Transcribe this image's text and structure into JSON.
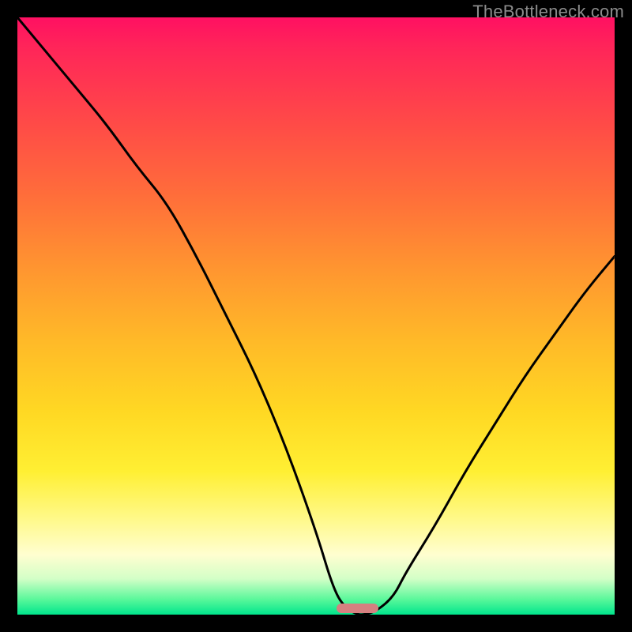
{
  "attribution": "TheBottleneck.com",
  "chart_data": {
    "type": "line",
    "title": "",
    "xlabel": "",
    "ylabel": "",
    "xlim": [
      0,
      100
    ],
    "ylim": [
      0,
      100
    ],
    "x": [
      0,
      5,
      10,
      15,
      20,
      25,
      30,
      35,
      40,
      45,
      50,
      53,
      55,
      57,
      58,
      60,
      63,
      65,
      70,
      75,
      80,
      85,
      90,
      95,
      100
    ],
    "values": [
      100,
      94,
      88,
      82,
      75,
      69,
      60,
      50,
      40,
      28,
      14,
      4,
      1,
      0,
      0,
      0.5,
      3,
      7,
      15,
      24,
      32,
      40,
      47,
      54,
      60
    ],
    "min_marker": {
      "x_center": 57,
      "width": 7,
      "y": 0
    }
  },
  "colors": {
    "curve": "#000000",
    "marker": "#d58080",
    "frame": "#000000"
  }
}
